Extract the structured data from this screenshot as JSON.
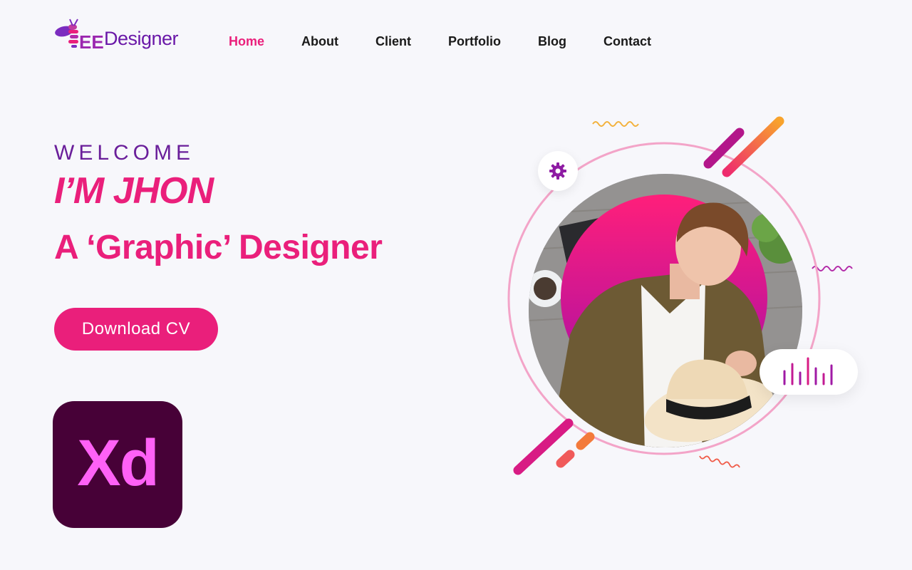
{
  "brand": {
    "logo_text": "EE Designer",
    "logo_label": "Designer"
  },
  "nav": {
    "items": [
      {
        "label": "Home",
        "active": true
      },
      {
        "label": "About",
        "active": false
      },
      {
        "label": "Client",
        "active": false
      },
      {
        "label": "Portfolio",
        "active": false
      },
      {
        "label": "Blog",
        "active": false
      },
      {
        "label": "Contact",
        "active": false
      }
    ]
  },
  "hero": {
    "welcome": "WELCOME",
    "name": "I’M JHON",
    "role": "A ‘Graphic’ Designer",
    "cta_label": "Download CV"
  },
  "badge": {
    "label": "Xd"
  },
  "colors": {
    "accent": "#ea1f7b",
    "purple": "#6a1e9a",
    "xd_bg": "#470137",
    "xd_fg": "#ff61f6"
  },
  "icons": {
    "settings": "gear-icon",
    "audio": "sound-bars-icon"
  }
}
